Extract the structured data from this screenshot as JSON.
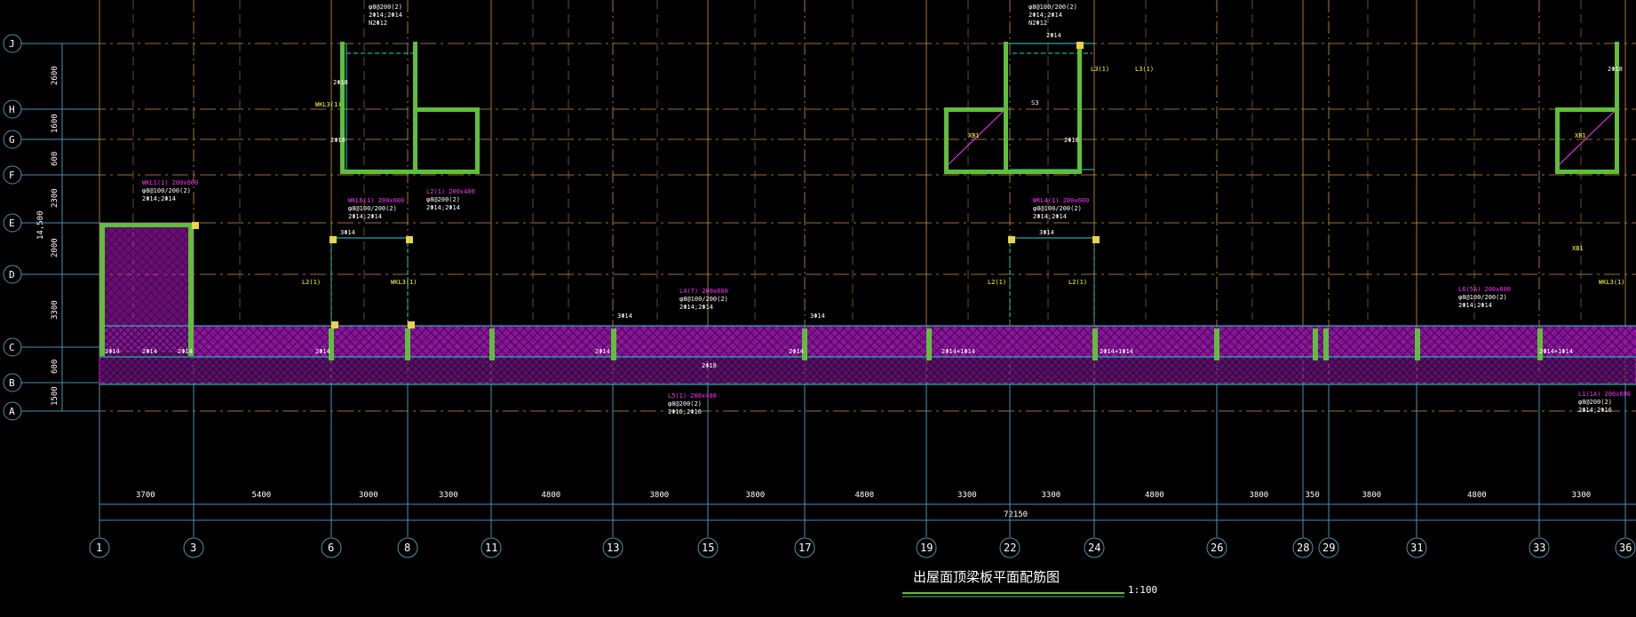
{
  "drawing": {
    "title": "出屋面顶梁板平面配筋图",
    "scale": "1:100",
    "colors": {
      "background": "#000000",
      "grid_line": "#c48a3c",
      "axis_line": "#4d8fb0",
      "column": "#5fbf3a",
      "slab_fill": "#c218c8",
      "hatch": "#7a1f9c",
      "beam_edge": "#22d3d3",
      "text_magenta": "#ff33ff",
      "text_yellow": "#ffff33",
      "text_white": "#ffffff"
    }
  },
  "row_axes": [
    "J",
    "H",
    "G",
    "F",
    "E",
    "D",
    "C",
    "B",
    "A"
  ],
  "row_dimensions": [
    "2600",
    "1600",
    "600",
    "2300",
    "2000",
    "3300",
    "600",
    "1500"
  ],
  "row_total": "14,500",
  "column_axes": [
    "1",
    "3",
    "6",
    "8",
    "11",
    "13",
    "15",
    "17",
    "19",
    "22",
    "24",
    "26",
    "28",
    "29",
    "31",
    "33",
    "36"
  ],
  "column_dimensions": [
    "3700",
    "5400",
    "3000",
    "3300",
    "4800",
    "3800",
    "3800",
    "4800",
    "3300",
    "3300",
    "4800",
    "3800",
    "350",
    "3800",
    "4800",
    "3300"
  ],
  "column_total": "72150",
  "annotations": [
    {
      "lines": [
        "φ8@200(2)",
        "2Φ14;2Φ14",
        "N2Φ12"
      ],
      "color": "white"
    },
    {
      "lines": [
        "φ8@100/200(2)",
        "2Φ14;2Φ14",
        "N2Φ12"
      ],
      "color": "white"
    },
    {
      "lines": [
        "WKL6(1) 200x600",
        "φ8@100/200(2)",
        "2Φ14;2Φ14"
      ],
      "color": "magenta"
    },
    {
      "lines": [
        "WKL4(1) 200x600",
        "φ8@100/200(2)",
        "2Φ14;2Φ14"
      ],
      "color": "magenta"
    },
    {
      "lines": [
        "L2(1) 200x400",
        "φ8@200(2)",
        "2Φ14;2Φ14"
      ],
      "color": "magenta"
    },
    {
      "lines": [
        "WKL1(1) 200x600",
        "φ8@100/200(2)",
        "2Φ14;2Φ14"
      ],
      "color": "magenta"
    },
    {
      "lines": [
        "L4(7) 200x600",
        "φ8@100/200(2)",
        "2Φ14;2Φ14"
      ],
      "color": "magenta"
    },
    {
      "lines": [
        "L6(5A) 200x600",
        "φ8@100/200(2)",
        "2Φ14;2Φ14"
      ],
      "color": "magenta"
    },
    {
      "lines": [
        "L5(1) 200x400",
        "φ8@200(2)",
        "2Φ16;2Φ16"
      ],
      "color": "magenta"
    },
    {
      "lines": [
        "L1(1A) 200x600",
        "φ8@200(2)",
        "2Φ14;2Φ16"
      ],
      "color": "magenta"
    }
  ],
  "small_labels": [
    "3Φ14",
    "3Φ14",
    "3Φ14",
    "3Φ14",
    "2Φ14",
    "2Φ14",
    "2Φ14",
    "2Φ14",
    "2Φ14",
    "2Φ14",
    "2Φ14",
    "2Φ14+1Φ14",
    "2Φ14+1Φ14",
    "2Φ14+1Φ14",
    "2Φ18",
    "S3",
    "XB1",
    "XB1",
    "XB1",
    "L2(1)",
    "L2(1)",
    "L2(1)",
    "WKL3(1)",
    "WKL3(1)",
    "WKL3(1)",
    "L3(1)",
    "L3(1)",
    "2Φ18",
    "2Φ18",
    "2Φ18",
    "2Φ18"
  ]
}
